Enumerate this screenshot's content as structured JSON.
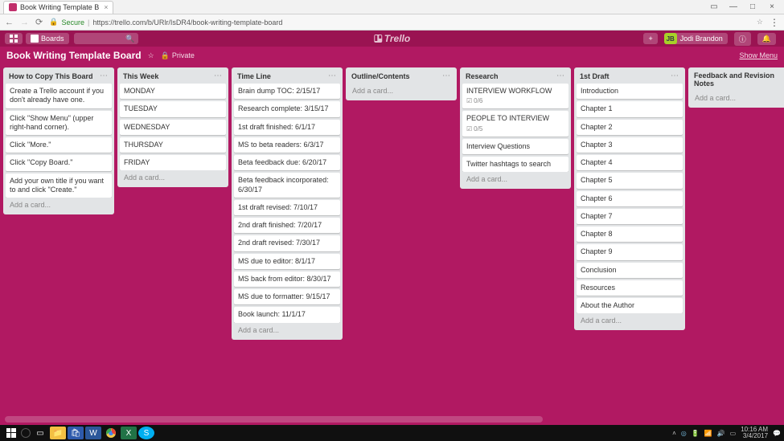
{
  "browser": {
    "tab_title": "Book Writing Template B",
    "secure_label": "Secure",
    "url": "https://trello.com/b/URlr/IsDR4/book-writing-template-board"
  },
  "header": {
    "boards_label": "Boards",
    "logo_text": "Trello",
    "plus": "+",
    "user_initials": "JB",
    "user_name": "Jodi Brandon"
  },
  "board_header": {
    "title": "Book Writing Template Board",
    "star": "☆",
    "privacy": "Private",
    "show_menu": "Show Menu"
  },
  "add_card_label": "Add a card...",
  "lists": [
    {
      "title": "How to Copy This Board",
      "cards": [
        {
          "text": "Create a Trello account if you don't already have one."
        },
        {
          "text": "Click \"Show Menu\" (upper right-hand corner)."
        },
        {
          "text": "Click \"More.\""
        },
        {
          "text": "Click \"Copy Board.\""
        },
        {
          "text": "Add your own title if you want to and click \"Create.\""
        }
      ]
    },
    {
      "title": "This Week",
      "cards": [
        {
          "text": "MONDAY"
        },
        {
          "text": "TUESDAY"
        },
        {
          "text": "WEDNESDAY"
        },
        {
          "text": "THURSDAY"
        },
        {
          "text": "FRIDAY"
        }
      ]
    },
    {
      "title": "Time Line",
      "cards": [
        {
          "text": "Brain dump TOC: 2/15/17"
        },
        {
          "text": "Research complete: 3/15/17"
        },
        {
          "text": "1st draft finished: 6/1/17"
        },
        {
          "text": "MS to beta readers: 6/3/17"
        },
        {
          "text": "Beta feedback due: 6/20/17"
        },
        {
          "text": "Beta feedback incorporated: 6/30/17"
        },
        {
          "text": "1st draft revised: 7/10/17"
        },
        {
          "text": "2nd draft finished: 7/20/17"
        },
        {
          "text": "2nd draft revised: 7/30/17"
        },
        {
          "text": "MS due to editor: 8/1/17"
        },
        {
          "text": "MS back from editor: 8/30/17"
        },
        {
          "text": "MS due to formatter: 9/15/17"
        },
        {
          "text": "Book launch: 11/1/17"
        }
      ]
    },
    {
      "title": "Outline/Contents",
      "cards": []
    },
    {
      "title": "Research",
      "cards": [
        {
          "text": "INTERVIEW WORKFLOW",
          "checklist": "0/6"
        },
        {
          "text": "PEOPLE TO INTERVIEW",
          "checklist": "0/5"
        },
        {
          "text": "Interview Questions"
        },
        {
          "text": "Twitter hashtags to search"
        }
      ]
    },
    {
      "title": "1st Draft",
      "cards": [
        {
          "text": "Introduction"
        },
        {
          "text": "Chapter 1"
        },
        {
          "text": "Chapter 2"
        },
        {
          "text": "Chapter 3"
        },
        {
          "text": "Chapter 4"
        },
        {
          "text": "Chapter 5"
        },
        {
          "text": "Chapter 6"
        },
        {
          "text": "Chapter 7"
        },
        {
          "text": "Chapter 8"
        },
        {
          "text": "Chapter 9"
        },
        {
          "text": "Conclusion"
        },
        {
          "text": "Resources"
        },
        {
          "text": "About the Author"
        }
      ]
    },
    {
      "title": "Feedback and Revision Notes",
      "cards": []
    }
  ],
  "taskbar": {
    "time": "10:16 AM",
    "date": "3/4/2017"
  }
}
